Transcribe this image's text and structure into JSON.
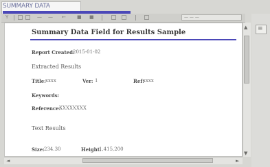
{
  "window": {
    "title": "SUMMARY DATA"
  },
  "toolbar": {
    "items": [
      "Y",
      "—",
      "—",
      "←",
      "■",
      "■"
    ],
    "zoom_field": "— — —"
  },
  "document": {
    "heading": "Summary Data Field for Results Sample",
    "report_created_label": "Report Created:",
    "report_created_value": "2015-01-02",
    "section_extracted": "Extracted Results",
    "fields": [
      {
        "label": "Title:",
        "value": "xxxx"
      },
      {
        "label": "Ver:",
        "value": "1"
      },
      {
        "label": "Ref:",
        "value": "xxxx"
      }
    ],
    "keywords_label": "Keywords:",
    "reference_label": "Reference:",
    "reference_value": "XXXXXXXX",
    "section_text": "Text Results",
    "footer_fields": [
      {
        "label": "Size:",
        "value": "234.30"
      },
      {
        "label": "Height:",
        "value": "1,415,200"
      }
    ]
  },
  "scrollbars": {
    "up_arrow": "▲",
    "down_arrow": "▼",
    "left_arrow": "◄",
    "right_arrow": "►"
  },
  "side_panel": {
    "button_glyph": "≡"
  },
  "colors": {
    "accent": "#4b48b8",
    "page": "#ffffff",
    "chrome": "#d7d7d3"
  }
}
